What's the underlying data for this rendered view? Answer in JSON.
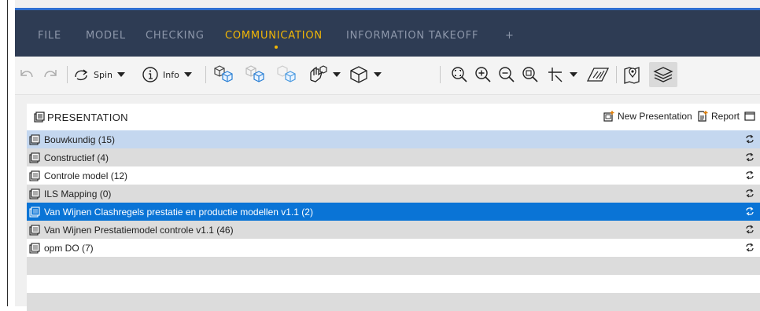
{
  "menu": {
    "items": [
      {
        "label": "FILE",
        "active": false
      },
      {
        "label": "MODEL",
        "active": false
      },
      {
        "label": "CHECKING",
        "active": false
      },
      {
        "label": "COMMUNICATION",
        "active": true
      },
      {
        "label": "INFORMATION TAKEOFF",
        "active": false
      },
      {
        "label": "+",
        "active": false
      }
    ]
  },
  "toolbar": {
    "spin_label": "Spin",
    "info_label": "Info"
  },
  "panel": {
    "title": "PRESENTATION",
    "new_presentation_label": "New Presentation",
    "report_label": "Report"
  },
  "presentations": [
    {
      "label": "Bouwkundig (15)",
      "state": "selected-soft"
    },
    {
      "label": "Constructief (4)",
      "state": "grey"
    },
    {
      "label": "Controle model (12)",
      "state": "light"
    },
    {
      "label": "ILS Mapping (0)",
      "state": "grey"
    },
    {
      "label": "Van Wijnen Clashregels prestatie en productie modellen v1.1 (2)",
      "state": "selected"
    },
    {
      "label": "Van Wijnen Prestatiemodel controle v1.1 (46)",
      "state": "grey"
    },
    {
      "label": "opm DO (7)",
      "state": "light"
    }
  ],
  "colors": {
    "menubar_bg": "#2e3c54",
    "menu_active": "#f2b705",
    "menu_inactive": "#8d97aa",
    "selection": "#0a74d6",
    "selection_soft": "#c4d7ef",
    "row_grey": "#dcdcdc"
  }
}
